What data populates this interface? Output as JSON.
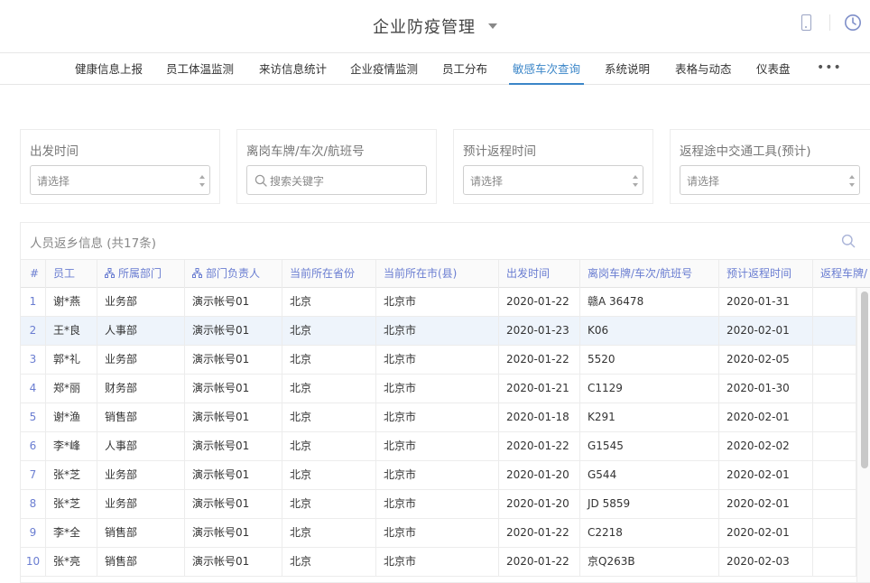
{
  "header": {
    "title": "企业防疫管理",
    "icons": [
      "chevron-down-icon",
      "mobile-phone-icon",
      "clock-icon"
    ]
  },
  "nav": {
    "tabs": [
      {
        "label": "健康信息上报"
      },
      {
        "label": "员工体温监测"
      },
      {
        "label": "来访信息统计"
      },
      {
        "label": "企业疫情监测"
      },
      {
        "label": "员工分布"
      },
      {
        "label": "敏感车次查询",
        "active": true
      },
      {
        "label": "系统说明"
      },
      {
        "label": "表格与动态"
      },
      {
        "label": "仪表盘"
      }
    ],
    "more": "•••"
  },
  "filters": [
    {
      "label": "出发时间",
      "placeholder": "请选择"
    },
    {
      "label": "离岗车牌/车次/航班号",
      "placeholder": "搜索关键字"
    },
    {
      "label": "预计返程时间",
      "placeholder": "请选择"
    },
    {
      "label": "返程途中交通工具(预计)",
      "placeholder": "请选择"
    }
  ],
  "table": {
    "title": "人员返乡信息 (共17条)",
    "columns": [
      "#",
      "员工",
      "所属部门",
      "部门负责人",
      "当前所在省份",
      "当前所在市(县)",
      "出发时间",
      "离岗车牌/车次/航班号",
      "预计返程时间",
      "返程车牌/"
    ],
    "rows": [
      [
        "1",
        "谢*燕",
        "业务部",
        "演示帐号01",
        "北京",
        "北京市",
        "2020-01-22",
        "赣A 36478",
        "2020-01-31",
        ""
      ],
      [
        "2",
        "王*良",
        "人事部",
        "演示帐号01",
        "北京",
        "北京市",
        "2020-01-23",
        "K06",
        "2020-02-01",
        ""
      ],
      [
        "3",
        "郭*礼",
        "业务部",
        "演示帐号01",
        "北京",
        "北京市",
        "2020-01-22",
        "5520",
        "2020-02-05",
        ""
      ],
      [
        "4",
        "郑*丽",
        "财务部",
        "演示帐号01",
        "北京",
        "北京市",
        "2020-01-21",
        "C1129",
        "2020-01-30",
        ""
      ],
      [
        "5",
        "谢*渔",
        "销售部",
        "演示帐号01",
        "北京",
        "北京市",
        "2020-01-18",
        "K291",
        "2020-02-01",
        ""
      ],
      [
        "6",
        "李*峰",
        "人事部",
        "演示帐号01",
        "北京",
        "北京市",
        "2020-01-22",
        "G1545",
        "2020-02-02",
        ""
      ],
      [
        "7",
        "张*芝",
        "业务部",
        "演示帐号01",
        "北京",
        "北京市",
        "2020-01-20",
        "G544",
        "2020-02-01",
        ""
      ],
      [
        "8",
        "张*芝",
        "业务部",
        "演示帐号01",
        "北京",
        "北京市",
        "2020-01-20",
        "JD 5859",
        "2020-02-01",
        ""
      ],
      [
        "9",
        "李*全",
        "销售部",
        "演示帐号01",
        "北京",
        "北京市",
        "2020-01-22",
        "C2218",
        "2020-02-01",
        ""
      ],
      [
        "10",
        "张*亮",
        "销售部",
        "演示帐号01",
        "北京",
        "北京市",
        "2020-01-22",
        "京Q263B",
        "2020-02-03",
        ""
      ]
    ],
    "selected_row": 2,
    "colors": {
      "accent": "#3b86c8",
      "header_text": "#6a7dd1",
      "selected_row_bg": "#eef4fb"
    }
  }
}
